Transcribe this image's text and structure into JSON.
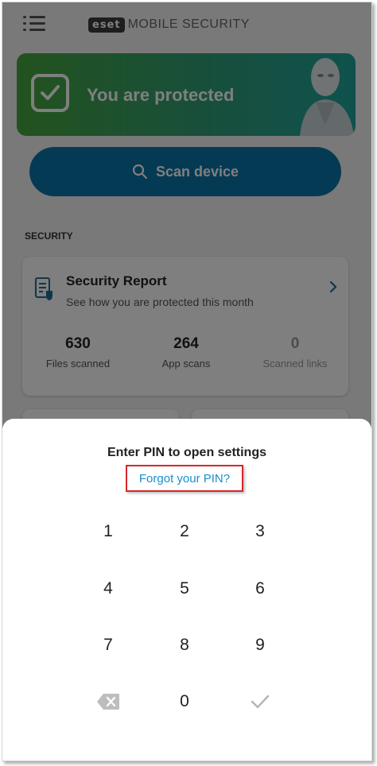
{
  "header": {
    "logo_text": "eset",
    "app_name": "MOBILE SECURITY"
  },
  "status": {
    "text": "You are protected"
  },
  "scan": {
    "label": "Scan device"
  },
  "security_section": {
    "label": "SECURITY"
  },
  "security_report": {
    "title": "Security Report",
    "subtitle": "See how you are protected this month",
    "stats": [
      {
        "value": "630",
        "label": "Files scanned"
      },
      {
        "value": "264",
        "label": "App scans"
      },
      {
        "value": "0",
        "label": "Scanned links"
      }
    ]
  },
  "pin_dialog": {
    "title": "Enter PIN to open settings",
    "forgot_link": "Forgot your PIN?",
    "keys": [
      "1",
      "2",
      "3",
      "4",
      "5",
      "6",
      "7",
      "8",
      "9",
      "0"
    ]
  },
  "colors": {
    "accent": "#0a74a8",
    "protected_start": "#46a63d",
    "protected_end": "#1ea59b",
    "link": "#1a8fc9",
    "highlight": "#d6262a"
  },
  "icons": [
    "hamburger-icon",
    "check-icon",
    "search-icon",
    "report-icon",
    "chevron-right-icon",
    "backspace-icon",
    "confirm-check-icon"
  ]
}
